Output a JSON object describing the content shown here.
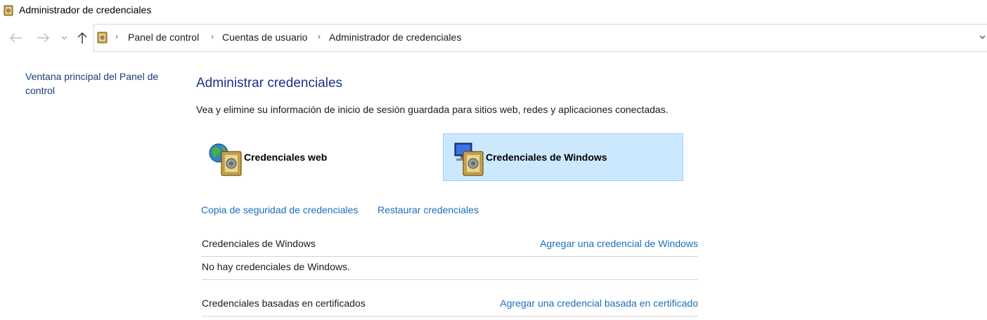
{
  "window": {
    "title": "Administrador de credenciales"
  },
  "nav": {
    "back_icon": "back-arrow-icon",
    "forward_icon": "forward-arrow-icon",
    "recent_icon": "chevron-down-icon",
    "up_icon": "up-arrow-icon"
  },
  "breadcrumb": [
    "Panel de control",
    "Cuentas de usuario",
    "Administrador de credenciales"
  ],
  "sidebar": {
    "home_link": "Ventana principal del Panel de control"
  },
  "main": {
    "title": "Administrar credenciales",
    "description": "Vea y elimine su información de inicio de sesión guardada para sitios web, redes y aplicaciones conectadas.",
    "tiles": [
      {
        "label": "Credenciales web",
        "icon": "globe-vault-icon",
        "selected": false
      },
      {
        "label": "Credenciales de Windows",
        "icon": "monitor-vault-icon",
        "selected": true
      }
    ],
    "backup_link": "Copia de seguridad de credenciales",
    "restore_link": "Restaurar credenciales",
    "sections": {
      "windows": {
        "title": "Credenciales de Windows",
        "add_link": "Agregar una credencial de Windows",
        "empty_text": "No hay credenciales de Windows."
      },
      "certificate": {
        "title": "Credenciales basadas en certificados",
        "add_link": "Agregar una credencial basada en certificado"
      }
    }
  },
  "colors": {
    "title_blue": "#1e3287",
    "link_blue": "#1a6fbf",
    "selected_tile_bg": "#cce8ff",
    "selected_tile_border": "#99d1ff"
  }
}
